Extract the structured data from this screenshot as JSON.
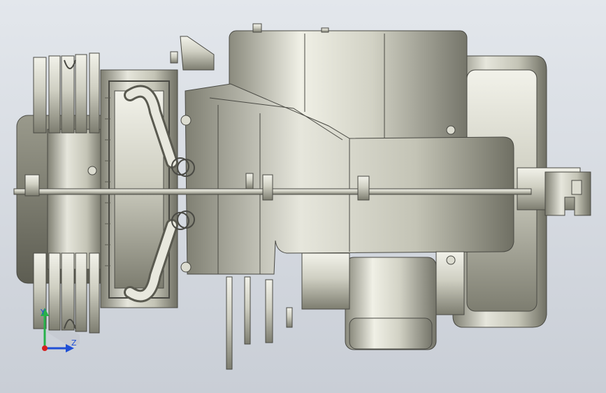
{
  "viewport": {
    "background_top": "#e3e7ec",
    "background_bottom": "#c9ced6",
    "model_color": "#cfcfc2",
    "edge_color": "#4a4a44"
  },
  "triad": {
    "y_label": "Y",
    "z_label": "Z",
    "y_color": "#27b14a",
    "z_color": "#1f4fd6",
    "x_color": "#d61f1f",
    "label_color": "#1f4fd6"
  }
}
